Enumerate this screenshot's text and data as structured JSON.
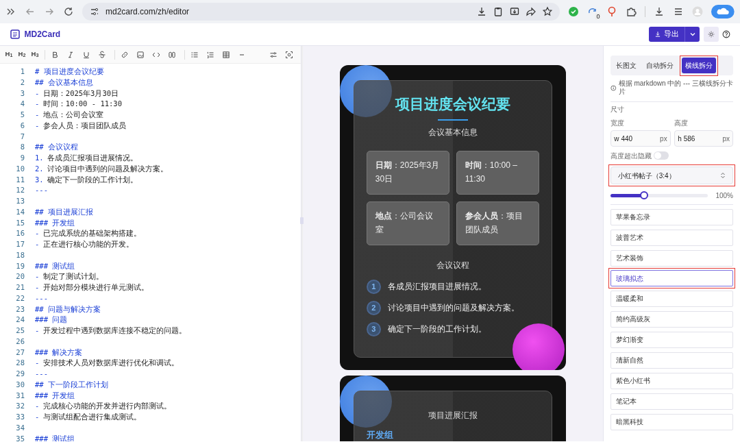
{
  "browser": {
    "url": "md2card.com/zh/editor",
    "badge": "0"
  },
  "header": {
    "logo": "MD2Card",
    "export": "导出"
  },
  "toolbar": {
    "headings": [
      "H$_{1}$",
      "H$_{2}$",
      "H$_{3}$"
    ]
  },
  "editor": {
    "lines": [
      {
        "n": "1",
        "kind": "heading",
        "marker": "#",
        "text": "项目进度会议纪要"
      },
      {
        "n": "2",
        "kind": "heading",
        "marker": "##",
        "text": "会议基本信息"
      },
      {
        "n": "3",
        "kind": "item",
        "marker": "-",
        "text": "**日期**：2025年3月30日"
      },
      {
        "n": "4",
        "kind": "item",
        "marker": "-",
        "text": "**时间**：10:00 - 11:30"
      },
      {
        "n": "5",
        "kind": "item",
        "marker": "-",
        "text": "**地点**：公司会议室"
      },
      {
        "n": "6",
        "kind": "item",
        "marker": "-",
        "text": "**参会人员**：项目团队成员"
      },
      {
        "n": "7",
        "kind": "blank"
      },
      {
        "n": "8",
        "kind": "heading",
        "marker": "##",
        "text": "会议议程"
      },
      {
        "n": "9",
        "kind": "item",
        "marker": "1.",
        "text": "各成员汇报项目进展情况。"
      },
      {
        "n": "10",
        "kind": "item",
        "marker": "2.",
        "text": "讨论项目中遇到的问题及解决方案。"
      },
      {
        "n": "11",
        "kind": "item",
        "marker": "3.",
        "text": "确定下一阶段的工作计划。"
      },
      {
        "n": "12",
        "kind": "rule",
        "marker": "---"
      },
      {
        "n": "13",
        "kind": "blank"
      },
      {
        "n": "14",
        "kind": "heading",
        "marker": "##",
        "text": "项目进展汇报"
      },
      {
        "n": "15",
        "kind": "heading",
        "marker": "###",
        "text": "开发组"
      },
      {
        "n": "16",
        "kind": "item",
        "marker": "-",
        "text": "已完成系统的基础架构搭建。"
      },
      {
        "n": "17",
        "kind": "item",
        "marker": "-",
        "text": "正在进行核心功能的开发。"
      },
      {
        "n": "18",
        "kind": "blank"
      },
      {
        "n": "19",
        "kind": "heading",
        "marker": "###",
        "text": "测试组"
      },
      {
        "n": "20",
        "kind": "item",
        "marker": "-",
        "text": "制定了测试计划。"
      },
      {
        "n": "21",
        "kind": "item",
        "marker": "-",
        "text": "开始对部分模块进行单元测试。"
      },
      {
        "n": "22",
        "kind": "rule",
        "marker": "---"
      },
      {
        "n": "23",
        "kind": "heading",
        "marker": "##",
        "text": "问题与解决方案"
      },
      {
        "n": "24",
        "kind": "heading",
        "marker": "###",
        "text": "问题"
      },
      {
        "n": "25",
        "kind": "item",
        "marker": "-",
        "text": "开发过程中遇到数据库连接不稳定的问题。"
      },
      {
        "n": "26",
        "kind": "blank"
      },
      {
        "n": "27",
        "kind": "heading",
        "marker": "###",
        "text": "解决方案"
      },
      {
        "n": "28",
        "kind": "item",
        "marker": "-",
        "text": "安排技术人员对数据库进行优化和调试。"
      },
      {
        "n": "29",
        "kind": "rule",
        "marker": "---"
      },
      {
        "n": "30",
        "kind": "heading",
        "marker": "##",
        "text": "下一阶段工作计划"
      },
      {
        "n": "31",
        "kind": "heading",
        "marker": "###",
        "text": "开发组"
      },
      {
        "n": "32",
        "kind": "item",
        "marker": "-",
        "text": "完成核心功能的开发并进行内部测试。"
      },
      {
        "n": "33",
        "kind": "item",
        "marker": "-",
        "text": "与测试组配合进行集成测试。"
      },
      {
        "n": "34",
        "kind": "blank"
      },
      {
        "n": "35",
        "kind": "heading",
        "marker": "###",
        "text": "测试组"
      }
    ]
  },
  "preview": {
    "cards": [
      {
        "title": "项目进度会议纪要",
        "subtitle": "会议基本信息",
        "info": [
          "**日期**：2025年3月30日",
          "**时间**：10:00 – 11:30",
          "**地点**：公司会议室",
          "**参会人员**：项目团队成员"
        ],
        "agenda_title": "会议议程",
        "agenda": [
          {
            "num": "1",
            "text": "各成员汇报项目进展情况。"
          },
          {
            "num": "2",
            "text": "讨论项目中遇到的问题及解决方案。"
          },
          {
            "num": "3",
            "text": "确定下一阶段的工作计划。"
          }
        ]
      },
      {
        "subtitle": "项目进展汇报",
        "section": "开发组"
      }
    ]
  },
  "panel": {
    "tabs": [
      {
        "label": "长图文",
        "selected": false
      },
      {
        "label": "自动拆分",
        "selected": false
      },
      {
        "label": "横线拆分",
        "selected": true,
        "highlighted": true
      }
    ],
    "hint": "根据 markdown 中的 --- 三横线拆分卡片",
    "size_title": "尺寸",
    "fields": [
      {
        "label": "宽度",
        "prefix": "w",
        "value": "440",
        "suffix": "px"
      },
      {
        "label": "高度",
        "prefix": "h",
        "value": "586",
        "suffix": "px"
      }
    ],
    "toggle": {
      "label": "高度超出隐藏",
      "on": false
    },
    "select": {
      "value": "小红书帖子（3:4）",
      "highlighted": true
    },
    "zoom": {
      "level": 0.34,
      "reading": "100%"
    },
    "styles": [
      {
        "label": "苹果备忘录",
        "selected": false
      },
      {
        "label": "波普艺术",
        "selected": false
      },
      {
        "label": "艺术装饰",
        "selected": false
      },
      {
        "label": "玻璃拟态",
        "selected": true,
        "highlighted": true
      },
      {
        "label": "温暖柔和",
        "selected": false
      },
      {
        "label": "简约高级灰",
        "selected": false
      },
      {
        "label": "梦幻渐变",
        "selected": false
      },
      {
        "label": "清新自然",
        "selected": false
      },
      {
        "label": "紫色小红书",
        "selected": false
      },
      {
        "label": "笔记本",
        "selected": false
      },
      {
        "label": "暗黑科技",
        "selected": false
      }
    ]
  }
}
